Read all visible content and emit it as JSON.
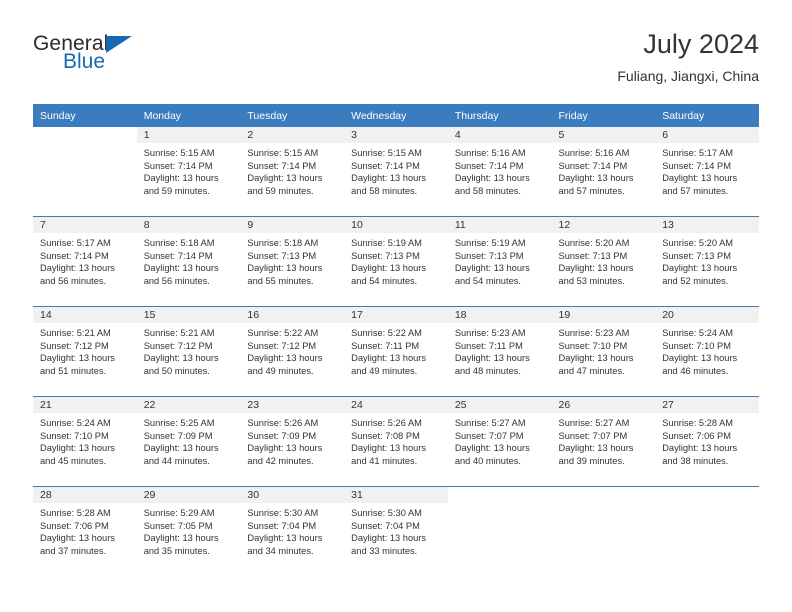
{
  "logo": {
    "name_dark": "General",
    "name_blue": "Blue",
    "icon": "triangle-logo-icon",
    "accent_color": "#1569b0"
  },
  "header": {
    "title": "July 2024",
    "subtitle": "Fuliang, Jiangxi, China"
  },
  "theme": {
    "header_row_color": "#3b7cbf",
    "daynum_band_color": "#f1f1f1",
    "text_color": "#333333"
  },
  "weekday_headers": [
    "Sunday",
    "Monday",
    "Tuesday",
    "Wednesday",
    "Thursday",
    "Friday",
    "Saturday"
  ],
  "weeks": [
    [
      {
        "day": "",
        "sunrise": "",
        "sunset": "",
        "daylight_line1": "",
        "daylight_line2": ""
      },
      {
        "day": "1",
        "sunrise": "Sunrise: 5:15 AM",
        "sunset": "Sunset: 7:14 PM",
        "daylight_line1": "Daylight: 13 hours",
        "daylight_line2": "and 59 minutes."
      },
      {
        "day": "2",
        "sunrise": "Sunrise: 5:15 AM",
        "sunset": "Sunset: 7:14 PM",
        "daylight_line1": "Daylight: 13 hours",
        "daylight_line2": "and 59 minutes."
      },
      {
        "day": "3",
        "sunrise": "Sunrise: 5:15 AM",
        "sunset": "Sunset: 7:14 PM",
        "daylight_line1": "Daylight: 13 hours",
        "daylight_line2": "and 58 minutes."
      },
      {
        "day": "4",
        "sunrise": "Sunrise: 5:16 AM",
        "sunset": "Sunset: 7:14 PM",
        "daylight_line1": "Daylight: 13 hours",
        "daylight_line2": "and 58 minutes."
      },
      {
        "day": "5",
        "sunrise": "Sunrise: 5:16 AM",
        "sunset": "Sunset: 7:14 PM",
        "daylight_line1": "Daylight: 13 hours",
        "daylight_line2": "and 57 minutes."
      },
      {
        "day": "6",
        "sunrise": "Sunrise: 5:17 AM",
        "sunset": "Sunset: 7:14 PM",
        "daylight_line1": "Daylight: 13 hours",
        "daylight_line2": "and 57 minutes."
      }
    ],
    [
      {
        "day": "7",
        "sunrise": "Sunrise: 5:17 AM",
        "sunset": "Sunset: 7:14 PM",
        "daylight_line1": "Daylight: 13 hours",
        "daylight_line2": "and 56 minutes."
      },
      {
        "day": "8",
        "sunrise": "Sunrise: 5:18 AM",
        "sunset": "Sunset: 7:14 PM",
        "daylight_line1": "Daylight: 13 hours",
        "daylight_line2": "and 56 minutes."
      },
      {
        "day": "9",
        "sunrise": "Sunrise: 5:18 AM",
        "sunset": "Sunset: 7:13 PM",
        "daylight_line1": "Daylight: 13 hours",
        "daylight_line2": "and 55 minutes."
      },
      {
        "day": "10",
        "sunrise": "Sunrise: 5:19 AM",
        "sunset": "Sunset: 7:13 PM",
        "daylight_line1": "Daylight: 13 hours",
        "daylight_line2": "and 54 minutes."
      },
      {
        "day": "11",
        "sunrise": "Sunrise: 5:19 AM",
        "sunset": "Sunset: 7:13 PM",
        "daylight_line1": "Daylight: 13 hours",
        "daylight_line2": "and 54 minutes."
      },
      {
        "day": "12",
        "sunrise": "Sunrise: 5:20 AM",
        "sunset": "Sunset: 7:13 PM",
        "daylight_line1": "Daylight: 13 hours",
        "daylight_line2": "and 53 minutes."
      },
      {
        "day": "13",
        "sunrise": "Sunrise: 5:20 AM",
        "sunset": "Sunset: 7:13 PM",
        "daylight_line1": "Daylight: 13 hours",
        "daylight_line2": "and 52 minutes."
      }
    ],
    [
      {
        "day": "14",
        "sunrise": "Sunrise: 5:21 AM",
        "sunset": "Sunset: 7:12 PM",
        "daylight_line1": "Daylight: 13 hours",
        "daylight_line2": "and 51 minutes."
      },
      {
        "day": "15",
        "sunrise": "Sunrise: 5:21 AM",
        "sunset": "Sunset: 7:12 PM",
        "daylight_line1": "Daylight: 13 hours",
        "daylight_line2": "and 50 minutes."
      },
      {
        "day": "16",
        "sunrise": "Sunrise: 5:22 AM",
        "sunset": "Sunset: 7:12 PM",
        "daylight_line1": "Daylight: 13 hours",
        "daylight_line2": "and 49 minutes."
      },
      {
        "day": "17",
        "sunrise": "Sunrise: 5:22 AM",
        "sunset": "Sunset: 7:11 PM",
        "daylight_line1": "Daylight: 13 hours",
        "daylight_line2": "and 49 minutes."
      },
      {
        "day": "18",
        "sunrise": "Sunrise: 5:23 AM",
        "sunset": "Sunset: 7:11 PM",
        "daylight_line1": "Daylight: 13 hours",
        "daylight_line2": "and 48 minutes."
      },
      {
        "day": "19",
        "sunrise": "Sunrise: 5:23 AM",
        "sunset": "Sunset: 7:10 PM",
        "daylight_line1": "Daylight: 13 hours",
        "daylight_line2": "and 47 minutes."
      },
      {
        "day": "20",
        "sunrise": "Sunrise: 5:24 AM",
        "sunset": "Sunset: 7:10 PM",
        "daylight_line1": "Daylight: 13 hours",
        "daylight_line2": "and 46 minutes."
      }
    ],
    [
      {
        "day": "21",
        "sunrise": "Sunrise: 5:24 AM",
        "sunset": "Sunset: 7:10 PM",
        "daylight_line1": "Daylight: 13 hours",
        "daylight_line2": "and 45 minutes."
      },
      {
        "day": "22",
        "sunrise": "Sunrise: 5:25 AM",
        "sunset": "Sunset: 7:09 PM",
        "daylight_line1": "Daylight: 13 hours",
        "daylight_line2": "and 44 minutes."
      },
      {
        "day": "23",
        "sunrise": "Sunrise: 5:26 AM",
        "sunset": "Sunset: 7:09 PM",
        "daylight_line1": "Daylight: 13 hours",
        "daylight_line2": "and 42 minutes."
      },
      {
        "day": "24",
        "sunrise": "Sunrise: 5:26 AM",
        "sunset": "Sunset: 7:08 PM",
        "daylight_line1": "Daylight: 13 hours",
        "daylight_line2": "and 41 minutes."
      },
      {
        "day": "25",
        "sunrise": "Sunrise: 5:27 AM",
        "sunset": "Sunset: 7:07 PM",
        "daylight_line1": "Daylight: 13 hours",
        "daylight_line2": "and 40 minutes."
      },
      {
        "day": "26",
        "sunrise": "Sunrise: 5:27 AM",
        "sunset": "Sunset: 7:07 PM",
        "daylight_line1": "Daylight: 13 hours",
        "daylight_line2": "and 39 minutes."
      },
      {
        "day": "27",
        "sunrise": "Sunrise: 5:28 AM",
        "sunset": "Sunset: 7:06 PM",
        "daylight_line1": "Daylight: 13 hours",
        "daylight_line2": "and 38 minutes."
      }
    ],
    [
      {
        "day": "28",
        "sunrise": "Sunrise: 5:28 AM",
        "sunset": "Sunset: 7:06 PM",
        "daylight_line1": "Daylight: 13 hours",
        "daylight_line2": "and 37 minutes."
      },
      {
        "day": "29",
        "sunrise": "Sunrise: 5:29 AM",
        "sunset": "Sunset: 7:05 PM",
        "daylight_line1": "Daylight: 13 hours",
        "daylight_line2": "and 35 minutes."
      },
      {
        "day": "30",
        "sunrise": "Sunrise: 5:30 AM",
        "sunset": "Sunset: 7:04 PM",
        "daylight_line1": "Daylight: 13 hours",
        "daylight_line2": "and 34 minutes."
      },
      {
        "day": "31",
        "sunrise": "Sunrise: 5:30 AM",
        "sunset": "Sunset: 7:04 PM",
        "daylight_line1": "Daylight: 13 hours",
        "daylight_line2": "and 33 minutes."
      },
      {
        "day": "",
        "sunrise": "",
        "sunset": "",
        "daylight_line1": "",
        "daylight_line2": ""
      },
      {
        "day": "",
        "sunrise": "",
        "sunset": "",
        "daylight_line1": "",
        "daylight_line2": ""
      },
      {
        "day": "",
        "sunrise": "",
        "sunset": "",
        "daylight_line1": "",
        "daylight_line2": ""
      }
    ]
  ]
}
